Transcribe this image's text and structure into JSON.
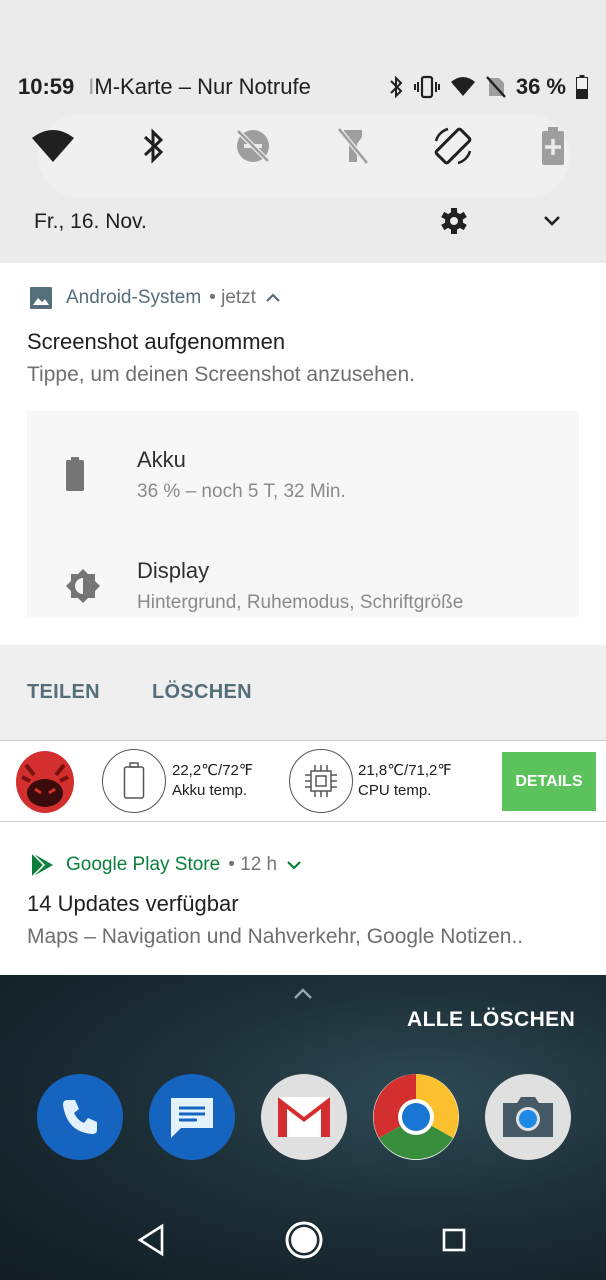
{
  "status_bar": {
    "time": "10:59",
    "carrier_faded": "I",
    "carrier": "M-Karte – Nur Notrufe",
    "battery": "36 %"
  },
  "quick_settings": {
    "tiles": [
      "wifi-icon",
      "bluetooth-icon",
      "do-not-disturb-off-icon",
      "flashlight-off-icon",
      "auto-rotate-icon",
      "battery-saver-icon"
    ],
    "date": "Fr., 16. Nov."
  },
  "notification_screenshot": {
    "app": "Android-System",
    "time": "• jetzt",
    "title": "Screenshot aufgenommen",
    "text": "Tippe, um deinen Screenshot anzusehen.",
    "preview": [
      {
        "title": "Akku",
        "subtitle": "36 % – noch 5 T, 32 Min."
      },
      {
        "title": "Display",
        "subtitle": "Hintergrund, Ruhemodus, Schriftgröße"
      }
    ],
    "actions": [
      "TEILEN",
      "LÖSCHEN"
    ]
  },
  "notification_antutu": {
    "battery_temp": "22,2℃/72℉",
    "battery_label": "Akku temp.",
    "cpu_temp": "21,8℃/71,2℉",
    "cpu_label": "CPU temp.",
    "details": "DETAILS"
  },
  "notification_play": {
    "app": "Google Play Store",
    "time": "• 12 h",
    "title": "14 Updates verfügbar",
    "text": "Maps – Navigation und Nahverkehr, Google Notizen.."
  },
  "clear_all": "ALLE LÖSCHEN",
  "dock": [
    "phone-icon",
    "messages-icon",
    "gmail-icon",
    "chrome-icon",
    "camera-icon"
  ],
  "colors": {
    "accent_blue_grey": "#546e7a",
    "play_green": "#0a7e3a",
    "details_green": "#5cc35c",
    "antutu_red": "#d32f2f"
  }
}
